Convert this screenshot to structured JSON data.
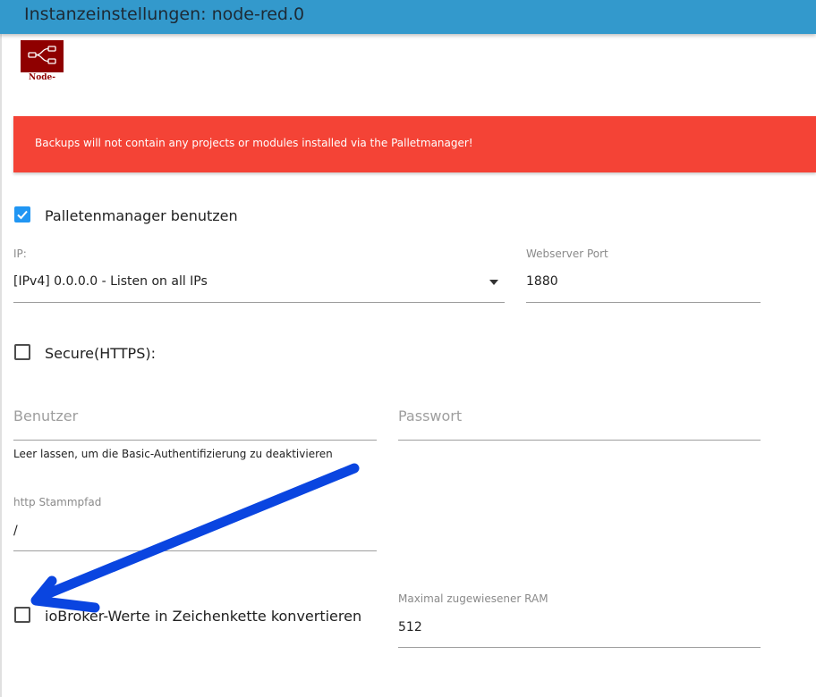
{
  "header": {
    "title": "Instanzeinstellungen: node-red.0"
  },
  "logo": {
    "label": "Node-RED"
  },
  "alert": {
    "text": "Backups will not contain any projects or modules installed via the Palletmanager!"
  },
  "palletmanager": {
    "label": "Palletenmanager benutzen",
    "checked": true
  },
  "ip": {
    "label": "IP:",
    "value": "[IPv4] 0.0.0.0 - Listen on all IPs"
  },
  "port": {
    "label": "Webserver Port",
    "value": "1880"
  },
  "secure": {
    "label": "Secure(HTTPS):",
    "checked": false
  },
  "user": {
    "placeholder": "Benutzer",
    "helper": "Leer lassen, um die Basic-Authentifizierung zu deaktivieren"
  },
  "password": {
    "placeholder": "Passwort"
  },
  "http_root": {
    "label": "http Stammpfad",
    "value": "/"
  },
  "convert": {
    "label": "ioBroker-Werte in Zeichenkette konvertieren",
    "checked": false
  },
  "ram": {
    "label": "Maximal zugewiesener RAM",
    "value": "512"
  },
  "colors": {
    "header": "#3399cc",
    "alert": "#f44336",
    "accent": "#2196f3",
    "annotation_arrow": "#0a45e0"
  },
  "icons": {
    "dropdown": "caret-down-icon",
    "check": "check-icon",
    "logo": "node-red-logo-icon"
  }
}
